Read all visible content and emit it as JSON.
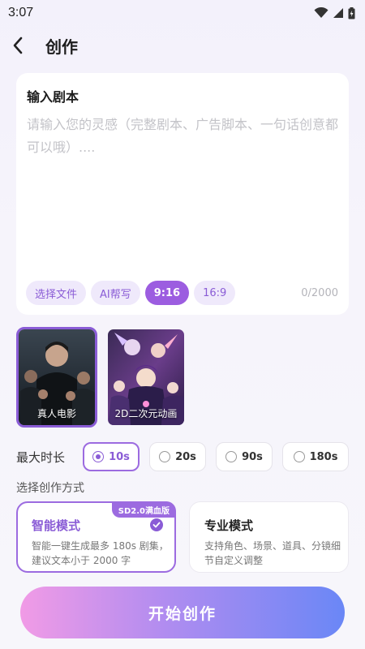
{
  "status_bar": {
    "time": "3:07",
    "icons": [
      "wifi-icon",
      "signal-icon",
      "battery-icon"
    ]
  },
  "header": {
    "title": "创作",
    "back_icon": "chevron-left-icon"
  },
  "script": {
    "title": "输入剧本",
    "placeholder": "请输入您的灵感（完整剧本、广告脚本、一句话创意都可以哦）....",
    "chips": [
      "选择文件",
      "AI帮写",
      "9:16",
      "16:9"
    ],
    "active_chip": "9:16",
    "char_count": "0/2000"
  },
  "styles": [
    {
      "label": "真人电影",
      "selected": true
    },
    {
      "label": "2D二次元动画",
      "selected": false
    }
  ],
  "duration": {
    "label": "最大时长",
    "options": [
      "10s",
      "20s",
      "90s",
      "180s"
    ],
    "selected": "10s"
  },
  "mode": {
    "section_label": "选择创作方式",
    "options": [
      {
        "title": "智能模式",
        "desc": "智能一键生成最多 180s 剧集，建议文本小于 2000 字",
        "badge": "SD2.0满血版",
        "selected": true
      },
      {
        "title": "专业模式",
        "desc": "支持角色、场景、道具、分镜细节自定义调整",
        "selected": false
      }
    ]
  },
  "start_button": "开始创作",
  "colors": {
    "accent": "#8a5cd6",
    "chip_bg": "#efe9fb",
    "button_start": "#f19be6",
    "button_end": "#6a87f6"
  }
}
